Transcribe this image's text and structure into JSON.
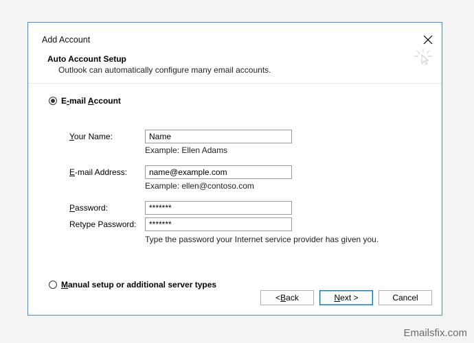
{
  "window": {
    "title": "Add Account"
  },
  "header": {
    "title": "Auto Account Setup",
    "subtitle": "Outlook can automatically configure many email accounts."
  },
  "radios": {
    "email_pre": "E",
    "email_u": "-",
    "email_post": "mail ",
    "email_u2": "A",
    "email_post2": "ccount",
    "manual_u": "M",
    "manual_post": "anual setup or additional server types"
  },
  "form": {
    "name_label_u": "Y",
    "name_label_post": "our Name:",
    "name_value": "Name",
    "name_example": "Example: Ellen Adams",
    "email_label_u": "E",
    "email_label_post": "-mail Address:",
    "email_value": "name@example.com",
    "email_example": "Example: ellen@contoso.com",
    "password_label_u": "P",
    "password_label_post": "assword:",
    "password_value": "*******",
    "retype_label": "Retype Password:",
    "retype_value": "*******",
    "password_hint": "Type the password your Internet service provider has given you."
  },
  "buttons": {
    "back_pre": "< ",
    "back_u": "B",
    "back_post": "ack",
    "next_u": "N",
    "next_post": "ext >",
    "cancel": "Cancel"
  },
  "watermark": "Emailsfix.com"
}
